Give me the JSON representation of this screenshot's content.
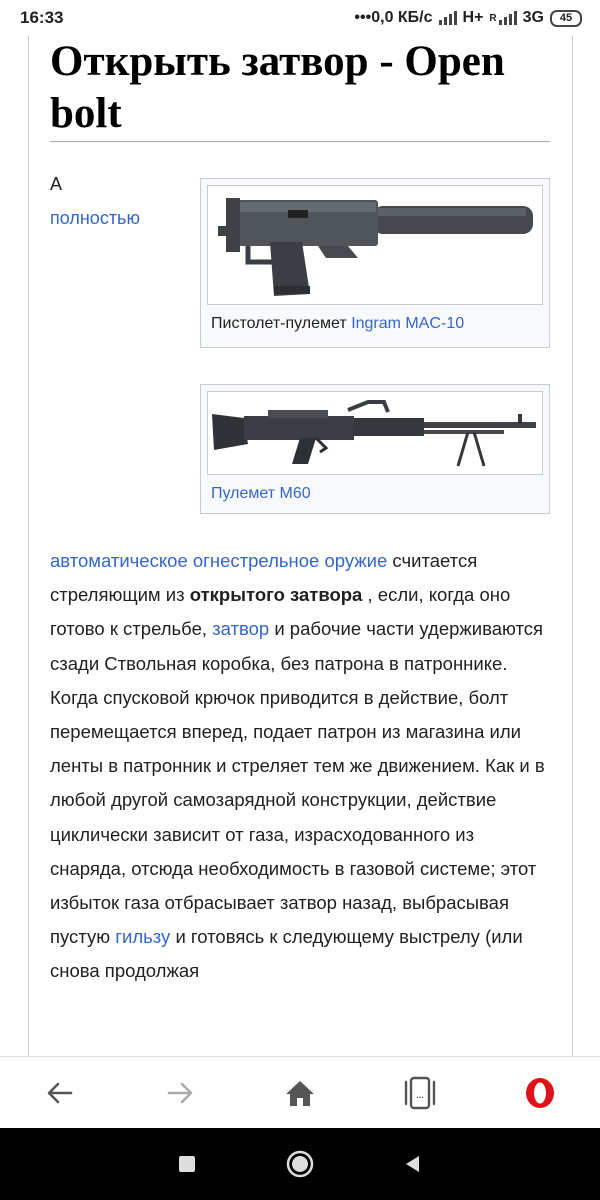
{
  "status_bar": {
    "time": "16:33",
    "network_speed": "0,0 КБ/с",
    "network_type_1": "H+",
    "roaming_marker": "R",
    "network_type_2": "3G",
    "battery": "45"
  },
  "article": {
    "title": "Открыть затвор - Open bolt",
    "lead_word": "A",
    "lead_link": "полностью",
    "figures": [
      {
        "caption_prefix": "Пистолет-пулемет",
        "caption_link": "Ingram MAC-10"
      },
      {
        "caption_link": "Пулемет М60"
      }
    ],
    "paragraph": {
      "link_1": "автоматическое огнестрельное оружие",
      "text_1": " считается стреляющим из ",
      "bold_1": "открытого затвора",
      "text_2": " , если, когда оно готово к стрельбе, ",
      "link_2": "затвор",
      "text_3": " и рабочие части удерживаются сзади Ствольная коробка, без патрона в патроннике. Когда спусковой крючок приводится в действие, болт перемещается вперед, подает патрон из магазина или ленты в патронник и стреляет тем же движением. Как и в любой другой самозарядной конструкции, действие циклически зависит от газа, израсходованного из снаряда, отсюда необходимость в газовой системе; этот избыток газа отбрасывает затвор назад, выбрасывая пустую ",
      "link_3": "гильзу",
      "text_4": " и готовясь к следующему выстрелу (или снова продолжая"
    }
  },
  "toolbar": {
    "back_icon": "arrow-left-icon",
    "forward_icon": "arrow-right-icon",
    "home_icon": "home-icon",
    "tabs_icon": "tabs-icon",
    "tabs_label": "...",
    "menu_icon": "opera-logo-icon",
    "accent": "#e0101a"
  },
  "system_nav": {
    "recent_icon": "square-icon",
    "home_icon": "circle-home-icon",
    "back_icon": "triangle-back-icon"
  },
  "colors": {
    "link": "#3366cc",
    "text": "#202122",
    "rule": "#a2a9b1"
  }
}
